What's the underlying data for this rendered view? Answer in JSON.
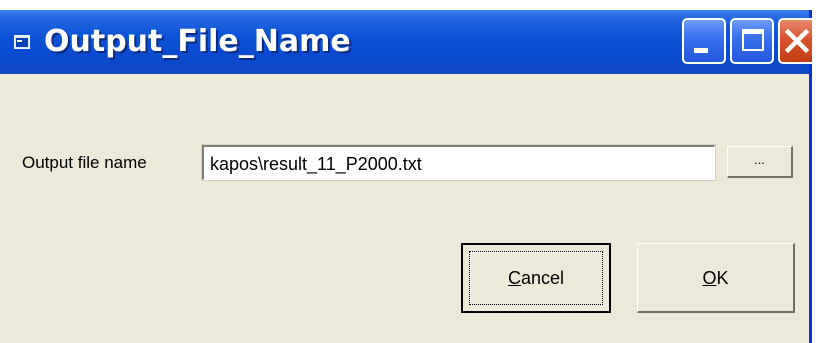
{
  "window": {
    "title": "Output_File_Name"
  },
  "titlebar": {
    "icons": {
      "app": "app-icon",
      "minimize": "minimize-icon",
      "maximize": "maximize-icon",
      "close": "close-icon"
    }
  },
  "form": {
    "label": "Output file name",
    "value": "kapos\\result_11_P2000.txt",
    "browse_label": "..."
  },
  "buttons": {
    "cancel_mnemonic": "C",
    "cancel_rest": "ancel",
    "ok_mnemonic": "O",
    "ok_rest": "K"
  },
  "colors": {
    "titlebar": "#0a4ad0",
    "close_button": "#d9532c",
    "dialog_face": "#ece9d8"
  }
}
